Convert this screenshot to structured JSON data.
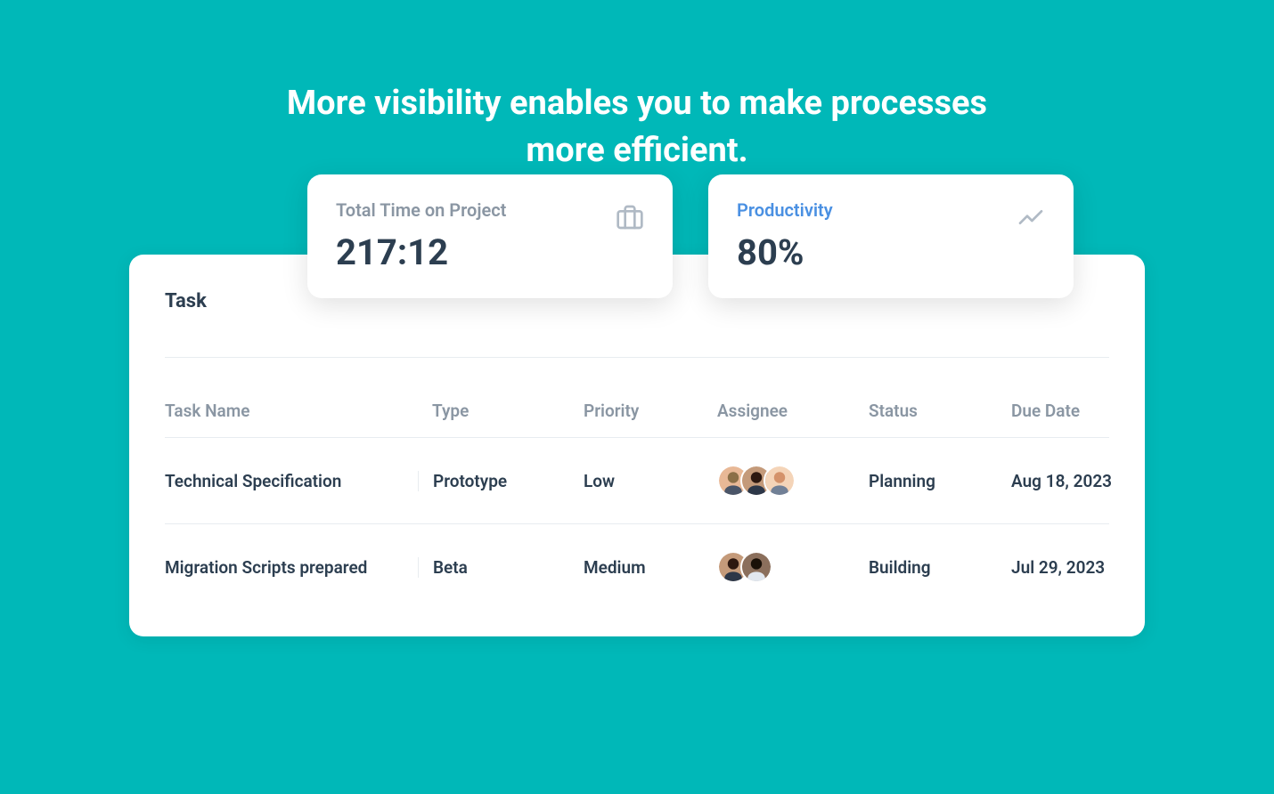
{
  "headline": "More visibility enables you to make processes more efficient.",
  "stats": {
    "timeOnProject": {
      "label": "Total Time on Project",
      "value": "217:12"
    },
    "productivity": {
      "label": "Productivity",
      "value": "80%"
    }
  },
  "task": {
    "title": "Task",
    "columns": {
      "name": "Task Name",
      "type": "Type",
      "priority": "Priority",
      "assignee": "Assignee",
      "status": "Status",
      "dueDate": "Due Date"
    },
    "rows": [
      {
        "name": "Technical Specification",
        "type": "Prototype",
        "priority": "Low",
        "assigneeCount": 3,
        "status": "Planning",
        "dueDate": "Aug 18, 2023"
      },
      {
        "name": "Migration Scripts prepared",
        "type": "Beta",
        "priority": "Medium",
        "assigneeCount": 2,
        "status": "Building",
        "dueDate": "Jul 29, 2023"
      }
    ]
  }
}
